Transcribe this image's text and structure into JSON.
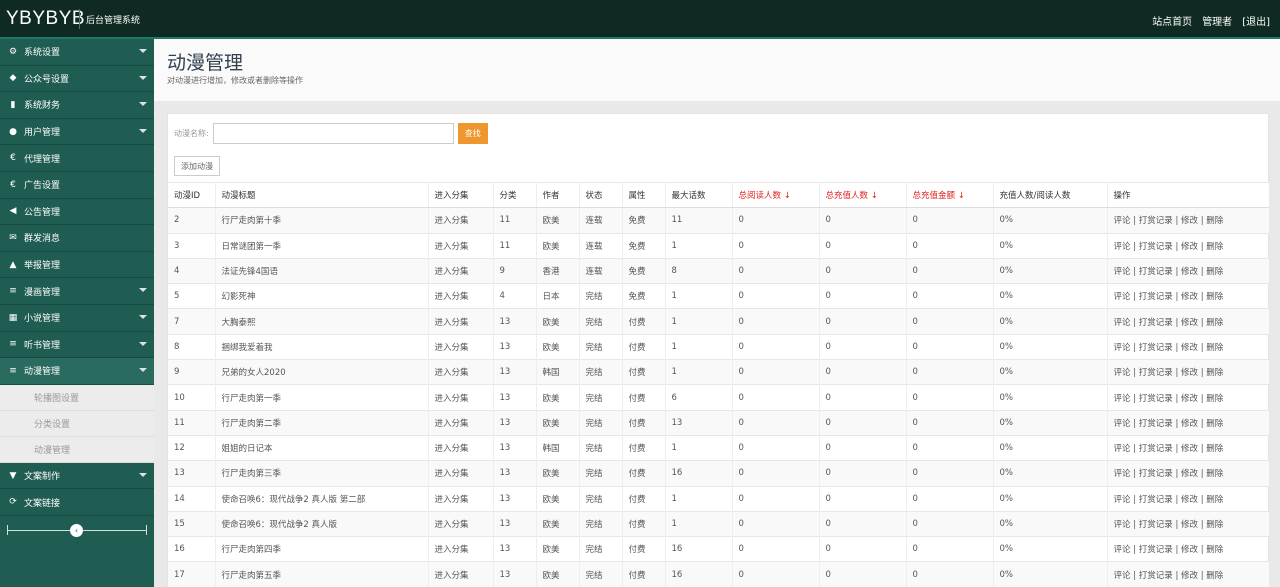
{
  "header": {
    "brand": "YBYBYB",
    "subtitle": "后台管理系统",
    "links": [
      "站点首页",
      "管理者",
      "[退出]"
    ]
  },
  "sidebar": {
    "items": [
      {
        "label": "系统设置",
        "icon": "gear-icon",
        "glyph": "⚙",
        "caret": true
      },
      {
        "label": "公众号设置",
        "icon": "tag-icon",
        "glyph": "◆",
        "caret": true
      },
      {
        "label": "系统财务",
        "icon": "bar-chart-icon",
        "glyph": "▮",
        "caret": true
      },
      {
        "label": "用户管理",
        "icon": "user-icon",
        "glyph": "●",
        "caret": true
      },
      {
        "label": "代理管理",
        "icon": "euro-icon",
        "glyph": "€",
        "caret": false
      },
      {
        "label": "广告设置",
        "icon": "euro-icon",
        "glyph": "€",
        "caret": false
      },
      {
        "label": "公告管理",
        "icon": "bullhorn-icon",
        "glyph": "◀",
        "caret": false
      },
      {
        "label": "群发消息",
        "icon": "envelope-icon",
        "glyph": "✉",
        "caret": false
      },
      {
        "label": "举报管理",
        "icon": "warning-icon",
        "glyph": "▲",
        "caret": false
      },
      {
        "label": "漫画管理",
        "icon": "list-icon",
        "glyph": "≡",
        "caret": true
      },
      {
        "label": "小说管理",
        "icon": "grid-icon",
        "glyph": "▦",
        "caret": true
      },
      {
        "label": "听书管理",
        "icon": "tasks-icon",
        "glyph": "≡",
        "caret": true
      },
      {
        "label": "动漫管理",
        "icon": "list-icon",
        "glyph": "≡",
        "caret": true,
        "active": true
      }
    ],
    "sub_items": [
      "轮播图设置",
      "分类设置",
      "动漫管理"
    ],
    "bottom_items": [
      {
        "label": "文案制作",
        "icon": "inbox-icon",
        "glyph": "▼",
        "caret": true
      },
      {
        "label": "文案链接",
        "icon": "share-icon",
        "glyph": "⟳",
        "caret": false
      }
    ],
    "collapse_glyph": "‹"
  },
  "page": {
    "title": "动漫管理",
    "description": "对动漫进行增加，修改或者删除等操作"
  },
  "search": {
    "label": "动漫名称:",
    "value": "",
    "placeholder": "",
    "button": "查找"
  },
  "add_button": "添加动漫",
  "table": {
    "columns": [
      {
        "label": "动漫ID",
        "red": false
      },
      {
        "label": "动漫标题",
        "red": false
      },
      {
        "label": "进入分集",
        "red": false
      },
      {
        "label": "分类",
        "red": false
      },
      {
        "label": "作者",
        "red": false
      },
      {
        "label": "状态",
        "red": false
      },
      {
        "label": "属性",
        "red": false
      },
      {
        "label": "最大话数",
        "red": false
      },
      {
        "label": "总阅读人数 ↓",
        "red": true
      },
      {
        "label": "总充值人数 ↓",
        "red": true
      },
      {
        "label": "总充值金额 ↓",
        "red": true
      },
      {
        "label": "充值人数/阅读人数",
        "red": false
      },
      {
        "label": "操作",
        "red": false
      }
    ],
    "rows": [
      [
        "2",
        "行尸走肉第十季",
        "进入分集",
        "11",
        "欧美",
        "连载",
        "免费",
        "11",
        "0",
        "0",
        "0",
        "0%",
        "评论 | 打赏记录 | 修改 | 删除"
      ],
      [
        "3",
        "日常谜团第一季",
        "进入分集",
        "11",
        "欧美",
        "连载",
        "免费",
        "1",
        "0",
        "0",
        "0",
        "0%",
        "评论 | 打赏记录 | 修改 | 删除"
      ],
      [
        "4",
        "法证先锋4国语",
        "进入分集",
        "9",
        "香港",
        "连载",
        "免费",
        "8",
        "0",
        "0",
        "0",
        "0%",
        "评论 | 打赏记录 | 修改 | 删除"
      ],
      [
        "5",
        "幻影死神",
        "进入分集",
        "4",
        "日本",
        "完结",
        "免费",
        "1",
        "0",
        "0",
        "0",
        "0%",
        "评论 | 打赏记录 | 修改 | 删除"
      ],
      [
        "7",
        "大胸泰熙",
        "进入分集",
        "13",
        "欧美",
        "完结",
        "付费",
        "1",
        "0",
        "0",
        "0",
        "0%",
        "评论 | 打赏记录 | 修改 | 删除"
      ],
      [
        "8",
        "捆绑我爱着我",
        "进入分集",
        "13",
        "欧美",
        "完结",
        "付费",
        "1",
        "0",
        "0",
        "0",
        "0%",
        "评论 | 打赏记录 | 修改 | 删除"
      ],
      [
        "9",
        "兄弟的女人2020",
        "进入分集",
        "13",
        "韩国",
        "完结",
        "付费",
        "1",
        "0",
        "0",
        "0",
        "0%",
        "评论 | 打赏记录 | 修改 | 删除"
      ],
      [
        "10",
        "行尸走肉第一季",
        "进入分集",
        "13",
        "欧美",
        "完结",
        "付费",
        "6",
        "0",
        "0",
        "0",
        "0%",
        "评论 | 打赏记录 | 修改 | 删除"
      ],
      [
        "11",
        "行尸走肉第二季",
        "进入分集",
        "13",
        "欧美",
        "完结",
        "付费",
        "13",
        "0",
        "0",
        "0",
        "0%",
        "评论 | 打赏记录 | 修改 | 删除"
      ],
      [
        "12",
        "姐姐的日记本",
        "进入分集",
        "13",
        "韩国",
        "完结",
        "付费",
        "1",
        "0",
        "0",
        "0",
        "0%",
        "评论 | 打赏记录 | 修改 | 删除"
      ],
      [
        "13",
        "行尸走肉第三季",
        "进入分集",
        "13",
        "欧美",
        "完结",
        "付费",
        "16",
        "0",
        "0",
        "0",
        "0%",
        "评论 | 打赏记录 | 修改 | 删除"
      ],
      [
        "14",
        "使命召唤6：现代战争2 真人版 第二部",
        "进入分集",
        "13",
        "欧美",
        "完结",
        "付费",
        "1",
        "0",
        "0",
        "0",
        "0%",
        "评论 | 打赏记录 | 修改 | 删除"
      ],
      [
        "15",
        "使命召唤6：现代战争2 真人版",
        "进入分集",
        "13",
        "欧美",
        "完结",
        "付费",
        "1",
        "0",
        "0",
        "0",
        "0%",
        "评论 | 打赏记录 | 修改 | 删除"
      ],
      [
        "16",
        "行尸走肉第四季",
        "进入分集",
        "13",
        "欧美",
        "完结",
        "付费",
        "16",
        "0",
        "0",
        "0",
        "0%",
        "评论 | 打赏记录 | 修改 | 删除"
      ],
      [
        "17",
        "行尸走肉第五季",
        "进入分集",
        "13",
        "欧美",
        "完结",
        "付费",
        "16",
        "0",
        "0",
        "0",
        "0%",
        "评论 | 打赏记录 | 修改 | 删除"
      ]
    ]
  }
}
